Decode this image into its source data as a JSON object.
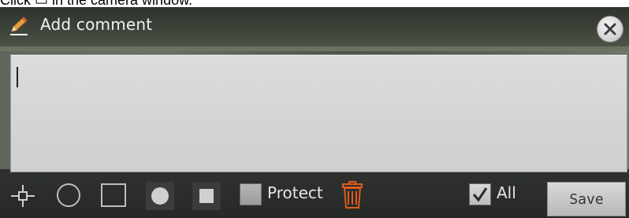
{
  "background_text": {
    "instruction_fragment": "Click ▭ in the camera window."
  },
  "dialog": {
    "title": "Add comment",
    "title_icon": "pencil-icon",
    "close_icon": "close-icon",
    "comment": {
      "value": "",
      "placeholder": ""
    },
    "toolbar": {
      "tools": [
        {
          "name": "move-tool",
          "icon": "crosshair-move-icon"
        },
        {
          "name": "circle-outline-tool",
          "icon": "circle-outline-icon"
        },
        {
          "name": "rectangle-outline-tool",
          "icon": "square-outline-icon"
        },
        {
          "name": "circle-filled-tool",
          "icon": "circle-filled-icon"
        },
        {
          "name": "rectangle-filled-tool",
          "icon": "square-filled-icon"
        }
      ],
      "protect_label": "Protect",
      "protect_checked": false,
      "delete_icon": "trash-icon",
      "all_label": "All",
      "all_checked": true,
      "save_label": "Save"
    }
  },
  "colors": {
    "delete_icon": "#e05a1c",
    "toolbar_bg": "#2b2d2b",
    "comment_bg": "#d4d4d4"
  }
}
